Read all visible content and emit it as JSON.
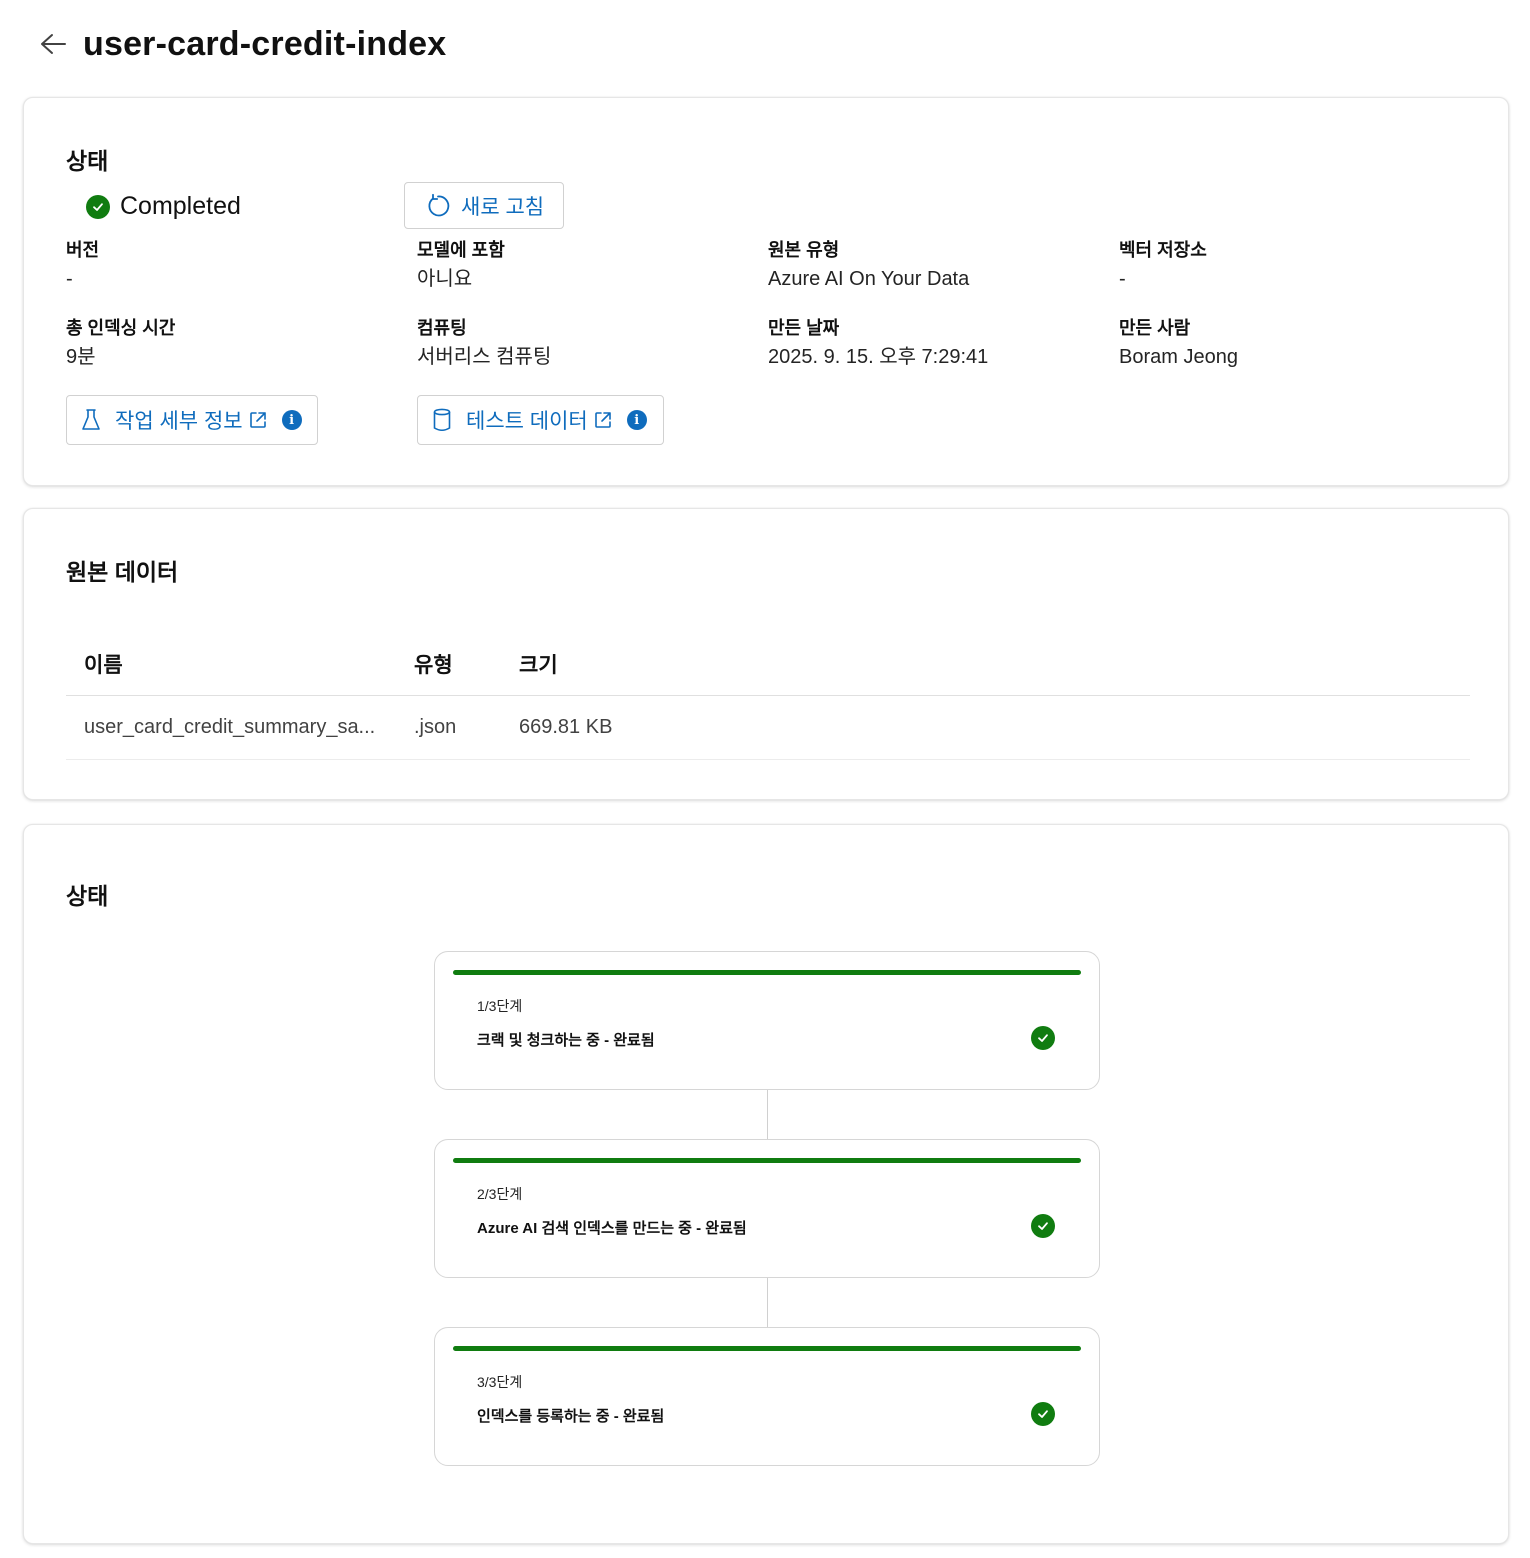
{
  "header": {
    "title": "user-card-credit-index"
  },
  "status_card": {
    "title": "상태",
    "status": "Completed",
    "refresh_label": "새로 고침",
    "fields": [
      {
        "label": "버전",
        "value": "-"
      },
      {
        "label": "모델에 포함",
        "value": "아니요"
      },
      {
        "label": "원본 유형",
        "value": "Azure AI On Your Data"
      },
      {
        "label": "벡터 저장소",
        "value": "-"
      },
      {
        "label": "총 인덱싱 시간",
        "value": "9분"
      },
      {
        "label": "컴퓨팅",
        "value": "서버리스 컴퓨팅"
      },
      {
        "label": "만든 날짜",
        "value": "2025. 9. 15. 오후 7:29:41"
      },
      {
        "label": "만든 사람",
        "value": "Boram Jeong"
      }
    ],
    "job_details_label": "작업 세부 정보",
    "test_data_label": "테스트 데이터"
  },
  "source_data": {
    "title": "원본 데이터",
    "columns": [
      "이름",
      "유형",
      "크기"
    ],
    "rows": [
      [
        "user_card_credit_summary_sa...",
        ".json",
        "669.81 KB"
      ]
    ]
  },
  "progress": {
    "title": "상태",
    "steps": [
      {
        "step": "1/3단계",
        "desc": "크랙 및 청크하는 중 - 완료됨"
      },
      {
        "step": "2/3단계",
        "desc": "Azure AI 검색 인덱스를 만드는 중 - 완료됨"
      },
      {
        "step": "3/3단계",
        "desc": "인덱스를 등록하는 중 - 완료됨"
      }
    ]
  },
  "colors": {
    "accent": "#0f6cbd",
    "success": "#107c10"
  }
}
